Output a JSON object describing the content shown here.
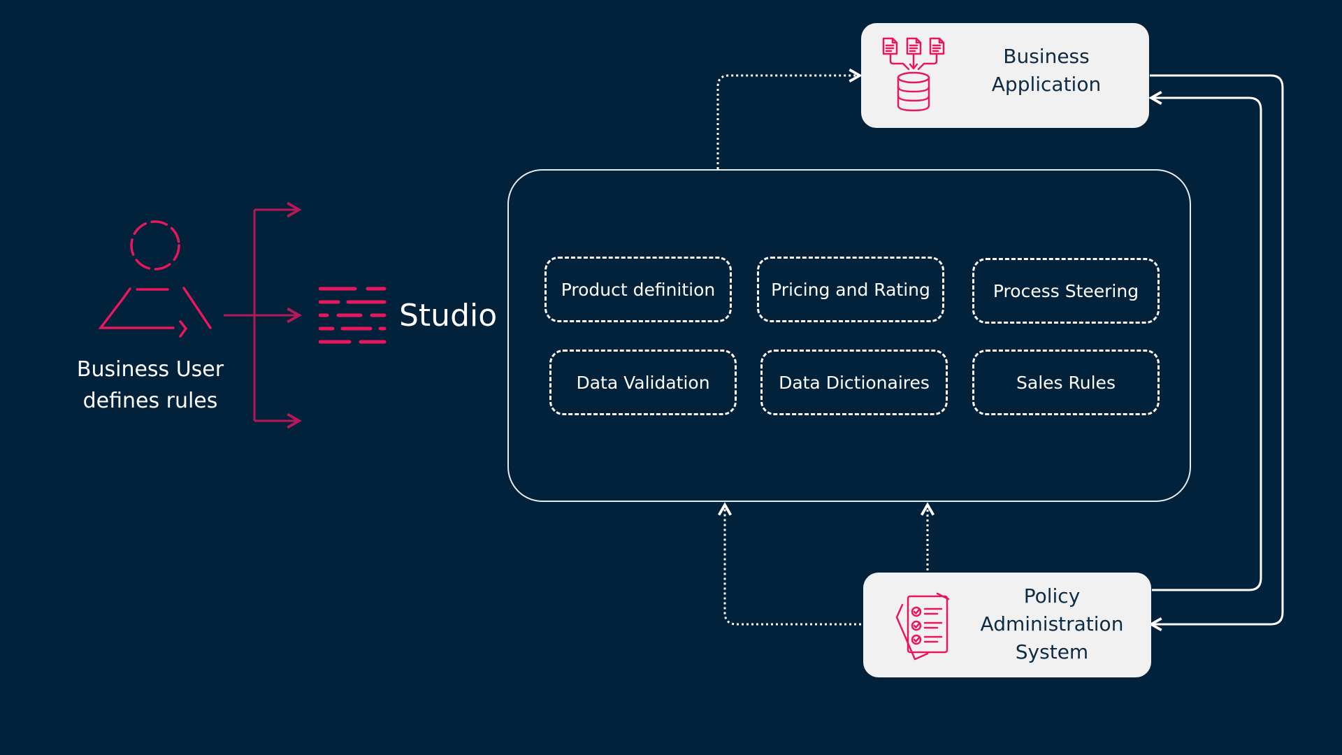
{
  "user": {
    "label_line1": "Business User",
    "label_line2": "defines rules",
    "icon": "person-icon"
  },
  "studio": {
    "label": "Studio",
    "icon": "studio-logo-icon"
  },
  "modules": [
    {
      "label": "Product definition"
    },
    {
      "label": "Pricing and Rating"
    },
    {
      "label": "Process Steering"
    },
    {
      "label": "Data Validation"
    },
    {
      "label": "Data Dictionaires"
    },
    {
      "label": "Sales Rules"
    }
  ],
  "business_app": {
    "line1": "Business",
    "line2": "Application",
    "icon": "documents-to-database-icon"
  },
  "pas": {
    "line1": "Policy",
    "line2": "Administration",
    "line3": "System",
    "icon": "checklist-documents-icon"
  },
  "colors": {
    "background": "#02213a",
    "accent": "#e8175d",
    "box": "#f1f1f2",
    "line": "#ffffff"
  }
}
